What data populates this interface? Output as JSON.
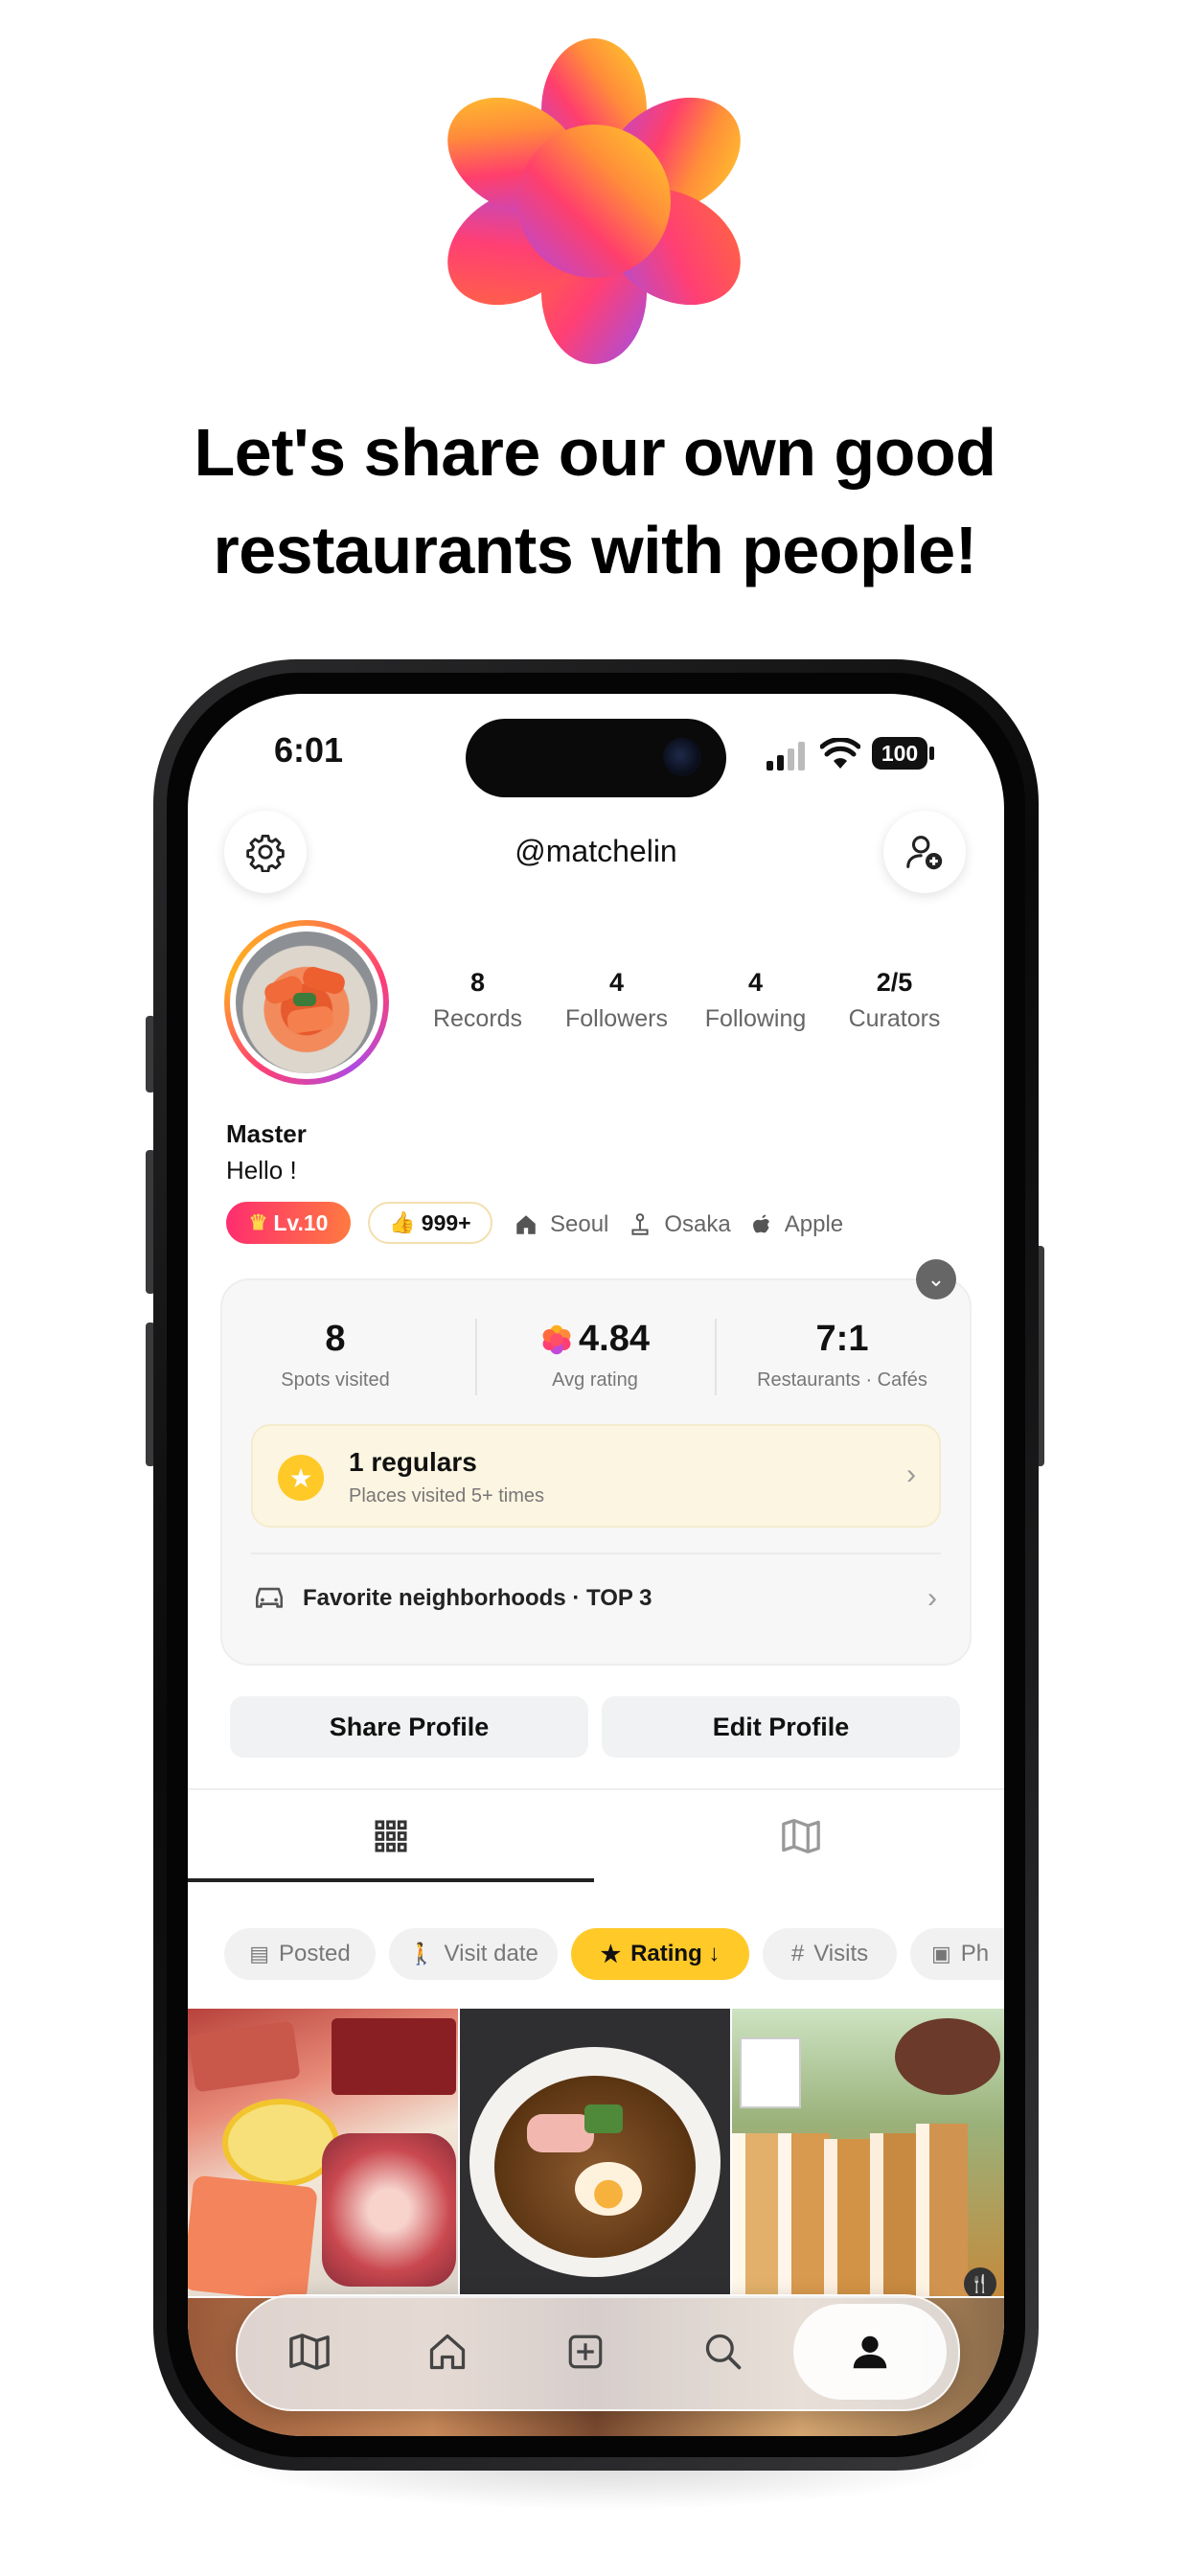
{
  "headline": {
    "line1": "Let's share our own good",
    "line2": "restaurants with people!"
  },
  "status_bar": {
    "time": "6:01",
    "battery": "100"
  },
  "header": {
    "username": "@matchelin"
  },
  "profile": {
    "stats": [
      {
        "value": "8",
        "label": "Records"
      },
      {
        "value": "4",
        "label": "Followers"
      },
      {
        "value": "4",
        "label": "Following"
      },
      {
        "value": "2/5",
        "label": "Curators"
      }
    ],
    "name": "Master",
    "bio": "Hello !",
    "level": "Lv.10",
    "likes": "999+",
    "tags": [
      "Seoul",
      "Osaka",
      "Apple"
    ]
  },
  "summary": {
    "spots": {
      "value": "8",
      "label": "Spots visited"
    },
    "rating": {
      "value": "4.84",
      "label": "Avg rating"
    },
    "ratio": {
      "value": "7:1",
      "label": "Restaurants · Cafés"
    },
    "regulars": {
      "title": "1 regulars",
      "subtitle": "Places visited 5+ times"
    },
    "neighborhoods": "Favorite neighborhoods · TOP 3"
  },
  "actions": {
    "share": "Share Profile",
    "edit": "Edit Profile"
  },
  "filters": [
    "Posted",
    "Visit date",
    "Rating ↓",
    "Visits",
    "Ph"
  ],
  "colors": {
    "accent_yellow": "#ffc928",
    "level_gradient_start": "#ff2d6f",
    "level_gradient_end": "#ff8a3c",
    "logo_orange": "#ffb01f",
    "logo_purple": "#a94dd8"
  }
}
